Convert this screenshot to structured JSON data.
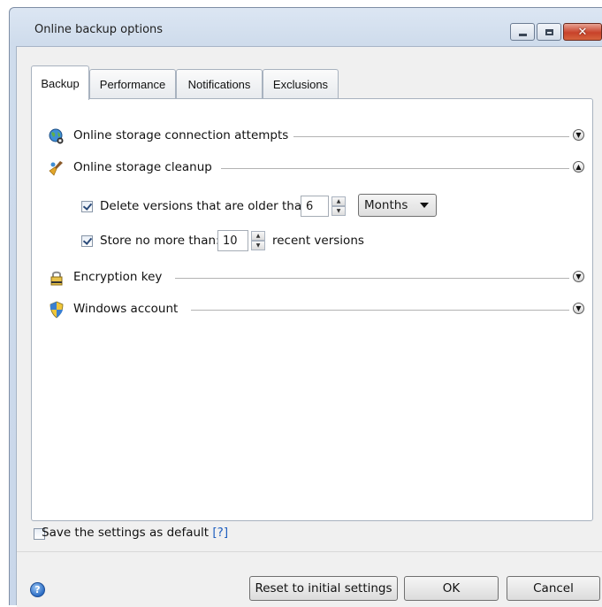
{
  "window": {
    "title": "Online backup options",
    "controls": {
      "minimize": "minimize-icon",
      "maximize": "maximize-icon",
      "close": "close-icon"
    }
  },
  "tabs": [
    {
      "label": "Backup",
      "active": true
    },
    {
      "label": "Performance",
      "active": false
    },
    {
      "label": "Notifications",
      "active": false
    },
    {
      "label": "Exclusions",
      "active": false
    }
  ],
  "sections": {
    "connection": {
      "label": "Online storage connection attempts",
      "icon": "globe-network-icon",
      "expanded": false
    },
    "cleanup": {
      "label": "Online storage cleanup",
      "icon": "broom-icon",
      "expanded": true,
      "delete_versions": {
        "label": "Delete versions that are older than:",
        "checked": true,
        "value": "6",
        "unit": "Months"
      },
      "store_limit": {
        "label": "Store no more than:",
        "checked": true,
        "value": "10",
        "suffix": "recent versions"
      }
    },
    "encryption": {
      "label": "Encryption key",
      "icon": "padlock-icon",
      "expanded": false
    },
    "windows_account": {
      "label": "Windows account",
      "icon": "shield-icon",
      "expanded": false
    }
  },
  "footer": {
    "save_default": {
      "label": "Save the settings as default",
      "help_link": "[?]",
      "checked": false
    },
    "buttons": {
      "reset": "Reset to initial settings",
      "ok": "OK",
      "cancel": "Cancel"
    },
    "help_icon": "help-icon"
  },
  "colors": {
    "title_gradient": "#cfdcec",
    "link": "#1f5fbf",
    "close_button": "#c8422a"
  }
}
